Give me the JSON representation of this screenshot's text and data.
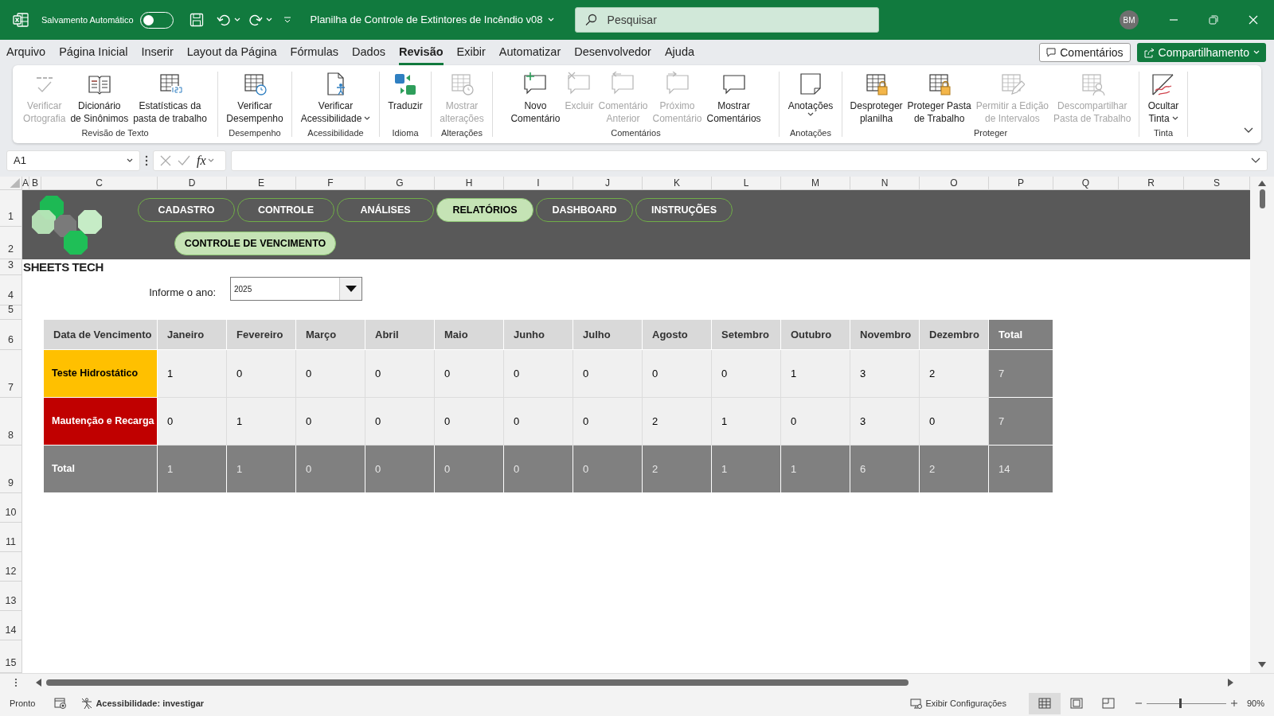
{
  "title_bar": {
    "autosave_label": "Salvamento Automático",
    "autosave_on": false,
    "document_title": "Planilha de Controle de Extintores de Incêndio v08",
    "search": {
      "placeholder": "Pesquisar"
    },
    "avatar": "BM"
  },
  "menu_tabs": [
    {
      "label": "Arquivo",
      "selected": false
    },
    {
      "label": "Página Inicial",
      "selected": false
    },
    {
      "label": "Inserir",
      "selected": false
    },
    {
      "label": "Layout da Página",
      "selected": false
    },
    {
      "label": "Fórmulas",
      "selected": false
    },
    {
      "label": "Dados",
      "selected": false
    },
    {
      "label": "Revisão",
      "selected": true
    },
    {
      "label": "Exibir",
      "selected": false
    },
    {
      "label": "Automatizar",
      "selected": false
    },
    {
      "label": "Desenvolvedor",
      "selected": false
    },
    {
      "label": "Ajuda",
      "selected": false
    }
  ],
  "menu_buttons": {
    "comments": "Comentários",
    "share": "Compartilhamento"
  },
  "ribbon": {
    "groups": [
      {
        "label": "Revisão de Texto",
        "items": [
          {
            "label": "Verificar\nOrtografia",
            "disabled": true,
            "dropdown": false
          },
          {
            "label": "Dicionário\nde Sinônimos",
            "disabled": false,
            "dropdown": false
          },
          {
            "label": "Estatísticas da\npasta de trabalho",
            "disabled": false,
            "dropdown": false
          }
        ]
      },
      {
        "label": "Desempenho",
        "items": [
          {
            "label": "Verificar\nDesempenho",
            "disabled": false,
            "dropdown": false
          }
        ]
      },
      {
        "label": "Acessibilidade",
        "items": [
          {
            "label": "Verificar\nAcessibilidade",
            "disabled": false,
            "dropdown": true
          }
        ]
      },
      {
        "label": "Idioma",
        "items": [
          {
            "label": "Traduzir",
            "disabled": false,
            "dropdown": false
          }
        ]
      },
      {
        "label": "Alterações",
        "items": [
          {
            "label": "Mostrar\nalterações",
            "disabled": true,
            "dropdown": false
          }
        ]
      },
      {
        "label": "Comentários",
        "items": [
          {
            "label": "Novo\nComentário",
            "disabled": false,
            "dropdown": false
          },
          {
            "label": "Excluir",
            "disabled": true,
            "dropdown": false
          },
          {
            "label": "Comentário\nAnterior",
            "disabled": true,
            "dropdown": false
          },
          {
            "label": "Próximo\nComentário",
            "disabled": true,
            "dropdown": false
          },
          {
            "label": "Mostrar\nComentários",
            "disabled": false,
            "dropdown": false
          }
        ]
      },
      {
        "label": "Anotações",
        "items": [
          {
            "label": "Anotações",
            "disabled": false,
            "dropdown": true
          }
        ]
      },
      {
        "label": "Proteger",
        "items": [
          {
            "label": "Desproteger\nplanilha",
            "disabled": false,
            "dropdown": false
          },
          {
            "label": "Proteger Pasta\nde Trabalho",
            "disabled": false,
            "dropdown": false
          },
          {
            "label": "Permitir a Edição\nde Intervalos",
            "disabled": true,
            "dropdown": false
          },
          {
            "label": "Descompartilhar\nPasta de Trabalho",
            "disabled": true,
            "dropdown": false
          }
        ]
      },
      {
        "label": "Tinta",
        "items": [
          {
            "label": "Ocultar\nTinta",
            "disabled": false,
            "dropdown": true
          }
        ]
      }
    ]
  },
  "formula_bar": {
    "name_box": "A1",
    "function_label": "fx"
  },
  "sheet": {
    "columns": [
      "A",
      "B",
      "C",
      "D",
      "E",
      "F",
      "G",
      "H",
      "I",
      "J",
      "K",
      "L",
      "M",
      "N",
      "O",
      "P",
      "Q",
      "R",
      "S"
    ],
    "rows": [
      "1",
      "2",
      "3",
      "4",
      "5",
      "6",
      "7",
      "8",
      "9",
      "10",
      "11",
      "12",
      "13",
      "14",
      "15"
    ],
    "nav_buttons": [
      [
        {
          "label": "CADASTRO",
          "selected": false
        },
        {
          "label": "CONTROLE",
          "selected": false
        },
        {
          "label": "ANÁLISES",
          "selected": false
        },
        {
          "label": "RELATÓRIOS",
          "selected": true
        },
        {
          "label": "DASHBOARD",
          "selected": false
        },
        {
          "label": "INSTRUÇÕES",
          "selected": false
        }
      ],
      [
        {
          "label": "CONTROLE DE VENCIMENTO",
          "selected": true
        }
      ]
    ],
    "brand": "SHEETS TECH",
    "year_label": "Informe o ano:",
    "year_value": "2025",
    "table": {
      "columns": [
        "Data de Vencimento",
        "Janeiro",
        "Fevereiro",
        "Março",
        "Abril",
        "Maio",
        "Junho",
        "Julho",
        "Agosto",
        "Setembro",
        "Outubro",
        "Novembro",
        "Dezembro",
        "Total"
      ],
      "rows": [
        {
          "kind": "category",
          "color": "#ffc000",
          "cells": [
            "Teste Hidrostático",
            "1",
            "0",
            "0",
            "0",
            "0",
            "0",
            "0",
            "0",
            "0",
            "1",
            "3",
            "2",
            "7"
          ]
        },
        {
          "kind": "category",
          "color": "#c00000",
          "cells": [
            "Mautenção e Recarga",
            "0",
            "1",
            "0",
            "0",
            "0",
            "0",
            "0",
            "2",
            "1",
            "0",
            "3",
            "0",
            "7"
          ]
        },
        {
          "kind": "total",
          "cells": [
            "Total",
            "1",
            "1",
            "0",
            "0",
            "0",
            "0",
            "0",
            "2",
            "1",
            "1",
            "6",
            "2",
            "14"
          ]
        }
      ]
    }
  },
  "status_bar": {
    "state": "Pronto",
    "accessibility": "Acessibilidade: investigar",
    "display_settings": "Exibir Configurações",
    "views": [
      {
        "selected": true
      },
      {
        "selected": false
      },
      {
        "selected": false
      }
    ],
    "zoom": {
      "level": 0.43,
      "reading": "90%"
    }
  }
}
